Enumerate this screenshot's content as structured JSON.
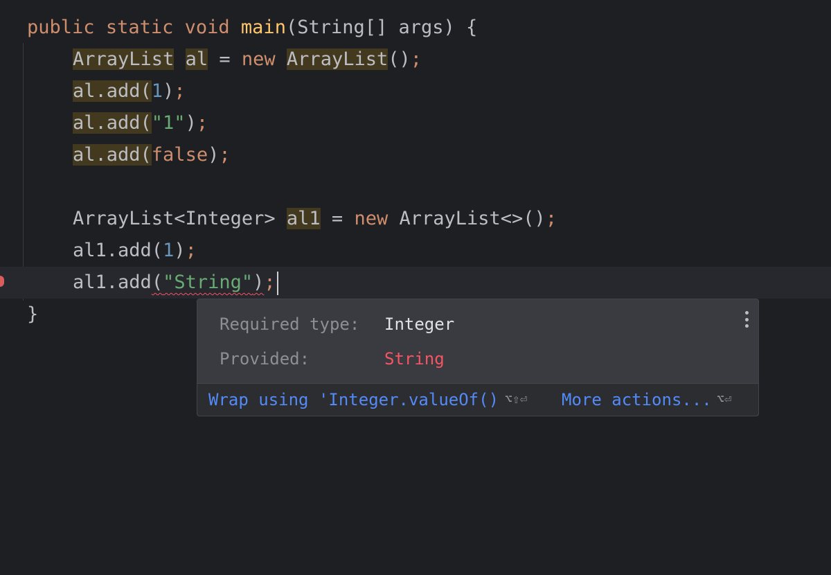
{
  "code": {
    "line1": {
      "kw1": "public",
      "kw2": "static",
      "kw3": "void",
      "fn": "main",
      "rest": "(String[] args) {"
    },
    "line2": {
      "type": "ArrayList",
      "var": "al",
      "eq": " = ",
      "kw": "new",
      "ctor": "ArrayList",
      "tail": "()",
      "semi": ";"
    },
    "line3": {
      "recv": "al",
      "call": ".add(",
      "arg": "1",
      "close": ")",
      "semi": ";"
    },
    "line4": {
      "recv": "al",
      "call": ".add(",
      "arg": "\"1\"",
      "close": ")",
      "semi": ";"
    },
    "line5": {
      "recv": "al",
      "call": ".add(",
      "arg": "false",
      "close": ")",
      "semi": ";"
    },
    "line7": {
      "type": "ArrayList<Integer>",
      "var": "al1",
      "eq": " = ",
      "kw": "new",
      "ctor": "ArrayList<>()",
      "semi": ";"
    },
    "line8": {
      "recv": "al1",
      "call": ".add(",
      "arg": "1",
      "close": ")",
      "semi": ";"
    },
    "line9": {
      "recv": "al1",
      "call": ".add",
      "paren": "(",
      "arg": "\"String\"",
      "close": ")",
      "semi": ";"
    },
    "line10": {
      "brace": "}"
    }
  },
  "popup": {
    "required_label": "Required type:",
    "required_value": "Integer",
    "provided_label": "Provided:",
    "provided_value": "String",
    "fix_action": "Wrap using 'Integer.valueOf()",
    "fix_shortcut": "⌥⇧⏎",
    "more_action": "More actions...",
    "more_shortcut": "⌥⏎"
  },
  "colors": {
    "background": "#1e1f22",
    "keyword": "#cf8e6d",
    "function": "#56a8f5",
    "string": "#6aab73",
    "number": "#2aacb8",
    "error": "#f75464",
    "link": "#548af7"
  }
}
